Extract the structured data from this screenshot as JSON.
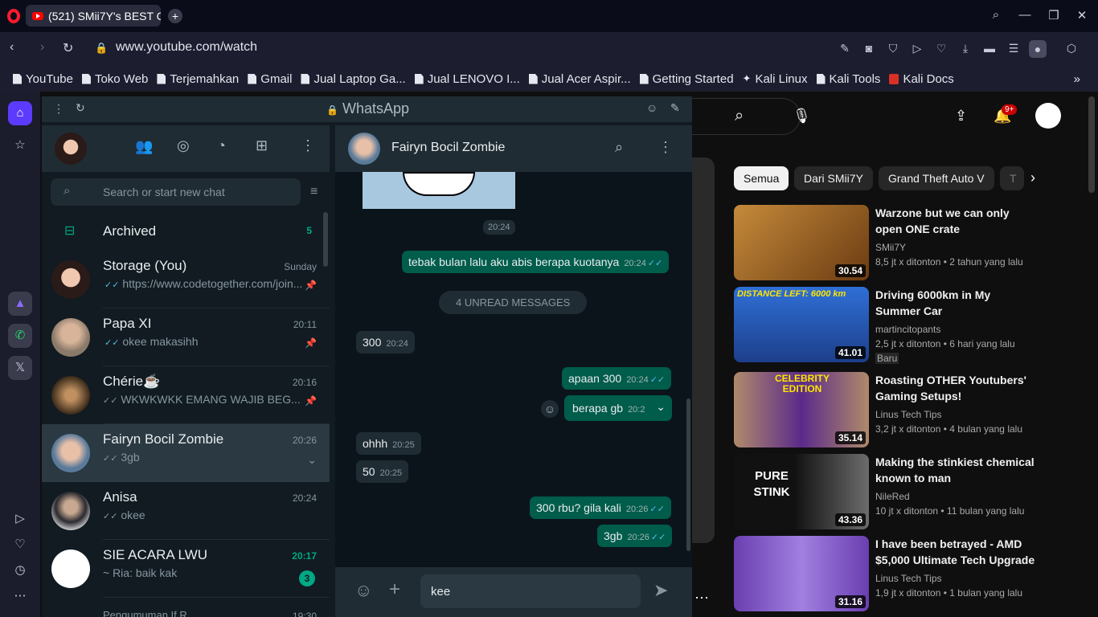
{
  "browser": {
    "tab_title": "(521) SMii7Y's BEST C",
    "url": "www.youtube.com/watch",
    "bookmarks": [
      "YouTube",
      "Toko Web",
      "Terjemahkan",
      "Gmail",
      "Jual Laptop Ga...",
      "Jual LENOVO I...",
      "Jual Acer Aspir...",
      "Getting Started",
      "Kali Linux",
      "Kali Tools",
      "Kali Docs"
    ]
  },
  "whatsapp": {
    "title": "WhatsApp",
    "search_placeholder": "Search or start new chat",
    "archived": {
      "label": "Archived",
      "count": "5"
    },
    "chats": [
      {
        "name": "Storage (You)",
        "time": "Sunday",
        "msg": "https://www.codetogether.com/join..."
      },
      {
        "name": "Papa XI",
        "time": "20:11",
        "msg": "okee makasihh"
      },
      {
        "name": "Chérie☕",
        "time": "20:16",
        "msg": "WKWKWKK EMANG WAJIB BEG..."
      },
      {
        "name": "Fairyn Bocil Zombie",
        "time": "20:26",
        "msg": "3gb"
      },
      {
        "name": "Anisa",
        "time": "20:24",
        "msg": "okee"
      },
      {
        "name": "SIE ACARA LWU",
        "time": "20:17",
        "msg": "~ Ria: baik kak",
        "unread": "3"
      },
      {
        "name": "Pengumuman If R...",
        "time": "19:30",
        "msg": ""
      }
    ],
    "active_chat": "Fairyn Bocil Zombie",
    "messages": {
      "time_center": "20:24",
      "m1": {
        "text": "tebak bulan lalu aku abis berapa kuotanya",
        "time": "20:24"
      },
      "unread": "4 UNREAD MESSAGES",
      "m2": {
        "text": "300",
        "time": "20:24"
      },
      "m3": {
        "text": "apaan 300",
        "time": "20:24"
      },
      "m4": {
        "text": "berapa gb",
        "time": "20:2"
      },
      "m5": {
        "text": "ohhh",
        "time": "20:25"
      },
      "m6": {
        "text": "50",
        "time": "20:25"
      },
      "m7": {
        "text": "300 rbu? gila kali",
        "time": "20:26"
      },
      "m8": {
        "text": "3gb",
        "time": "20:26"
      }
    },
    "composer_value": "kee"
  },
  "youtube": {
    "notif_count": "9+",
    "chips": [
      "Semua",
      "Dari SMii7Y",
      "Grand Theft Auto V",
      "T"
    ],
    "videos": [
      {
        "title": "Warzone but we can only open ONE crate",
        "channel": "SMii7Y",
        "meta": "8,5 jt x ditonton  •  2 tahun yang lalu",
        "dur": "30.54"
      },
      {
        "title": "Driving 6000km in My Summer Car",
        "channel": "martincitopants",
        "meta": "2,5 jt x ditonton  •  6 hari yang lalu",
        "badge": "Baru",
        "dur": "41.01",
        "thumb_text": "DISTANCE LEFT: 6000 km"
      },
      {
        "title": "Roasting OTHER Youtubers' Gaming Setups!",
        "channel": "Linus Tech Tips",
        "meta": "3,2 jt x ditonton  •  4 bulan yang lalu",
        "dur": "35.14",
        "thumb_text": "CELEBRITY EDITION"
      },
      {
        "title": "Making the stinkiest chemical known to man",
        "channel": "NileRed",
        "meta": "10 jt x ditonton  •  11 bulan yang lalu",
        "dur": "43.36",
        "thumb_text": "PURE STINK"
      },
      {
        "title": "I have been betrayed - AMD $5,000 Ultimate Tech Upgrade",
        "channel": "Linus Tech Tips",
        "meta": "1,9 jt x ditonton  •  1 bulan yang lalu",
        "dur": "31.16"
      }
    ]
  }
}
